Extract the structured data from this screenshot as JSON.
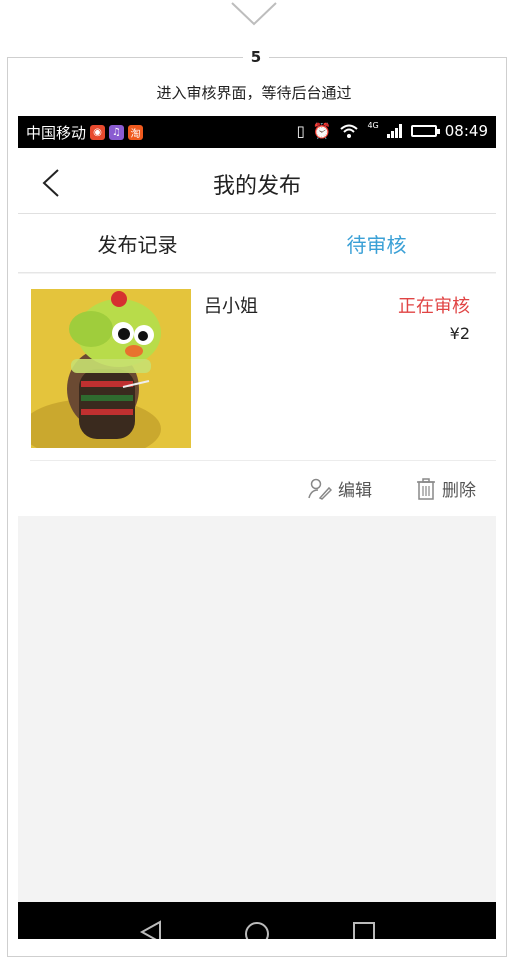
{
  "step": {
    "number": "5",
    "caption": "进入审核界面，等待后台通过"
  },
  "statusbar": {
    "carrier": "中国移动",
    "network": "4G",
    "time": "08:49"
  },
  "navbar": {
    "title": "我的发布"
  },
  "tabs": [
    {
      "label": "发布记录",
      "active": false
    },
    {
      "label": "待审核",
      "active": true
    }
  ],
  "listing": {
    "name": "吕小姐",
    "status": "正在审核",
    "price": "¥2",
    "actions": {
      "edit": "编辑",
      "delete": "删除"
    }
  },
  "colors": {
    "active_tab": "#3aa0d6",
    "status_red": "#e04444"
  }
}
